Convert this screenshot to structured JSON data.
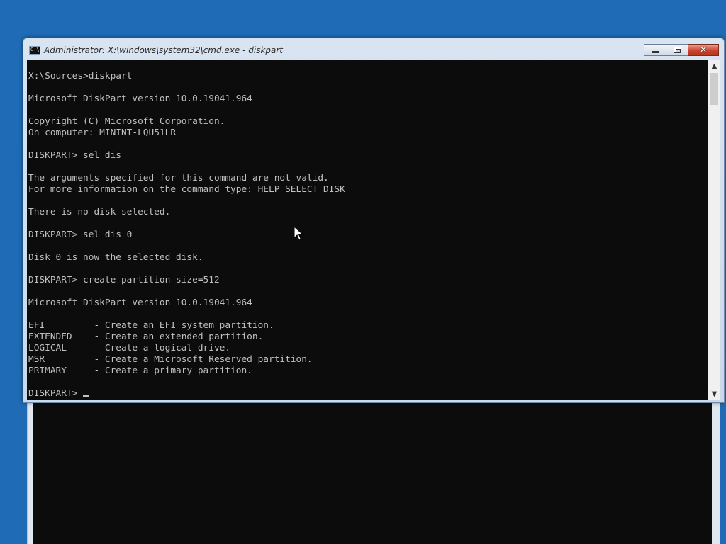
{
  "window": {
    "title": "Administrator: X:\\windows\\system32\\cmd.exe - diskpart",
    "icon_label": "C:\\",
    "close_glyph": "✕",
    "scroll_up_glyph": "▲",
    "scroll_down_glyph": "▼"
  },
  "console": {
    "text": "X:\\Sources>diskpart\n\nMicrosoft DiskPart version 10.0.19041.964\n\nCopyright (C) Microsoft Corporation.\nOn computer: MININT-LQU51LR\n\nDISKPART> sel dis\n\nThe arguments specified for this command are not valid.\nFor more information on the command type: HELP SELECT DISK\n\nThere is no disk selected.\n\nDISKPART> sel dis 0\n\nDisk 0 is now the selected disk.\n\nDISKPART> create partition size=512\n\nMicrosoft DiskPart version 10.0.19041.964\n\nEFI         - Create an EFI system partition.\nEXTENDED    - Create an extended partition.\nLOGICAL     - Create a logical drive.\nMSR         - Create a Microsoft Reserved partition.\nPRIMARY     - Create a primary partition.\n\n",
    "prompt": "DISKPART> "
  },
  "colors": {
    "desktop": "#1f6bb5",
    "console_bg": "#0c0c0c",
    "console_fg": "#c0c0c0"
  }
}
